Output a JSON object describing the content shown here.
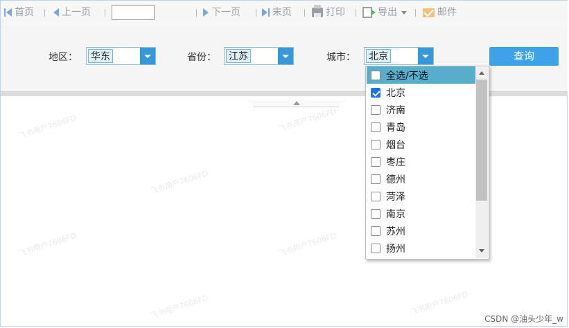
{
  "toolbar": {
    "first": "首页",
    "prev": "上一页",
    "page_value": "",
    "next": "下一页",
    "last": "末页",
    "print": "打印",
    "export": "导出",
    "mail": "邮件"
  },
  "filters": {
    "region_label": "地区：",
    "region_value": "华东",
    "province_label": "省份：",
    "province_value": "江苏",
    "city_label": "城市：",
    "city_value": "北京",
    "query_button": "查询"
  },
  "city_options": [
    {
      "label": "全选/不选",
      "checked": false
    },
    {
      "label": "北京",
      "checked": true
    },
    {
      "label": "济南",
      "checked": false
    },
    {
      "label": "青岛",
      "checked": false
    },
    {
      "label": "烟台",
      "checked": false
    },
    {
      "label": "枣庄",
      "checked": false
    },
    {
      "label": "德州",
      "checked": false
    },
    {
      "label": "菏泽",
      "checked": false
    },
    {
      "label": "南京",
      "checked": false
    },
    {
      "label": "苏州",
      "checked": false
    },
    {
      "label": "扬州",
      "checked": false
    }
  ],
  "watermark": "飞书用户7606FD",
  "footer": "CSDN @油头少年_w",
  "colors": {
    "accent": "#3498db",
    "query_button": "#3da2e8",
    "selected_row": "#5aaecd",
    "checkbox_checked": "#1a73e8"
  }
}
